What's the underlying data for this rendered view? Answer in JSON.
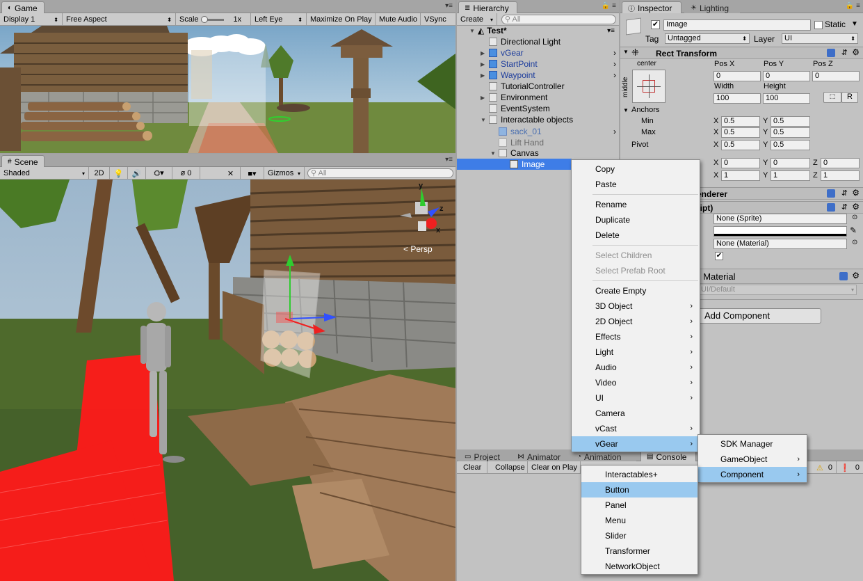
{
  "game": {
    "tab": "Game",
    "display": "Display 1",
    "aspect": "Free Aspect",
    "scale_label": "Scale",
    "scale_value": "1x",
    "eye": "Left Eye",
    "maximize": "Maximize On Play",
    "mute": "Mute Audio",
    "vsync": "VSync"
  },
  "scene": {
    "tab": "Scene",
    "shading": "Shaded",
    "mode_2d": "2D",
    "hidden_count": "0",
    "gizmos": "Gizmos",
    "search_placeholder": "All",
    "persp": "< Persp",
    "axis_y": "y",
    "axis_z": "z",
    "axis_x": "x"
  },
  "hierarchy": {
    "tab": "Hierarchy",
    "create": "Create",
    "search_placeholder": "All",
    "scene_name": "Test*",
    "items": [
      {
        "label": "Directional Light"
      },
      {
        "label": "vGear"
      },
      {
        "label": "StartPoint"
      },
      {
        "label": "Waypoint"
      },
      {
        "label": "TutorialController"
      },
      {
        "label": "Environment"
      },
      {
        "label": "EventSystem"
      },
      {
        "label": "Interactable objects"
      },
      {
        "label": "sack_01"
      },
      {
        "label": "Lift Hand"
      },
      {
        "label": "Canvas"
      },
      {
        "label": "Image"
      }
    ]
  },
  "inspector": {
    "tab": "Inspector",
    "tab2": "Lighting",
    "object_name": "Image",
    "static_label": "Static",
    "tag_label": "Tag",
    "tag_value": "Untagged",
    "layer_label": "Layer",
    "layer_value": "UI",
    "rect_transform": "Rect Transform",
    "anchor_h": "center",
    "anchor_v": "middle",
    "pos_x_label": "Pos X",
    "pos_y_label": "Pos Y",
    "pos_z_label": "Pos Z",
    "pos_x": "0",
    "pos_y": "0",
    "pos_z": "0",
    "width_label": "Width",
    "height_label": "Height",
    "width": "100",
    "height": "100",
    "r_button": "R",
    "anchors_label": "Anchors",
    "min_label": "Min",
    "max_label": "Max",
    "pivot_label": "Pivot",
    "x": "X",
    "y": "Y",
    "z": "Z",
    "min_x": "0.5",
    "min_y": "0.5",
    "max_x": "0.5",
    "max_y": "0.5",
    "pivot_x": "0.5",
    "pivot_y": "0.5",
    "rot_x": "0",
    "rot_y": "0",
    "rot_z": "0",
    "scale_x": "1",
    "scale_y": "1",
    "scale_z": "1",
    "renderer_partial": "enderer",
    "script_partial": "ript)",
    "sprite_value": "None (Sprite)",
    "material_value": "None (Material)",
    "material_header_partial": "I Material",
    "shader_value": "UI/Default",
    "add_component": "Add Component"
  },
  "bottom": {
    "tabs": [
      "Project",
      "Animator",
      "Animation",
      "Console"
    ],
    "console_clear": "Clear",
    "console_collapse": "Collapse",
    "console_clear_on_play": "Clear on Play",
    "count_warn": "0",
    "count_err": "0"
  },
  "context_menu": {
    "items": [
      "Copy",
      "Paste",
      "Rename",
      "Duplicate",
      "Delete",
      "Select Children",
      "Select Prefab Root",
      "Create Empty",
      "3D Object",
      "2D Object",
      "Effects",
      "Light",
      "Audio",
      "Video",
      "UI",
      "Camera",
      "vCast",
      "vGear"
    ]
  },
  "vgear_menu": {
    "items": [
      "SDK Manager",
      "GameObject",
      "Component"
    ]
  },
  "component_menu": {
    "items": [
      "Interactables+",
      "Button",
      "Panel",
      "Menu",
      "Slider",
      "Transformer",
      "NetworkObject"
    ]
  },
  "colors": {
    "highlight": "#99c9ef",
    "selection": "#3e7de7",
    "floor_red": "#ff1a1a"
  }
}
